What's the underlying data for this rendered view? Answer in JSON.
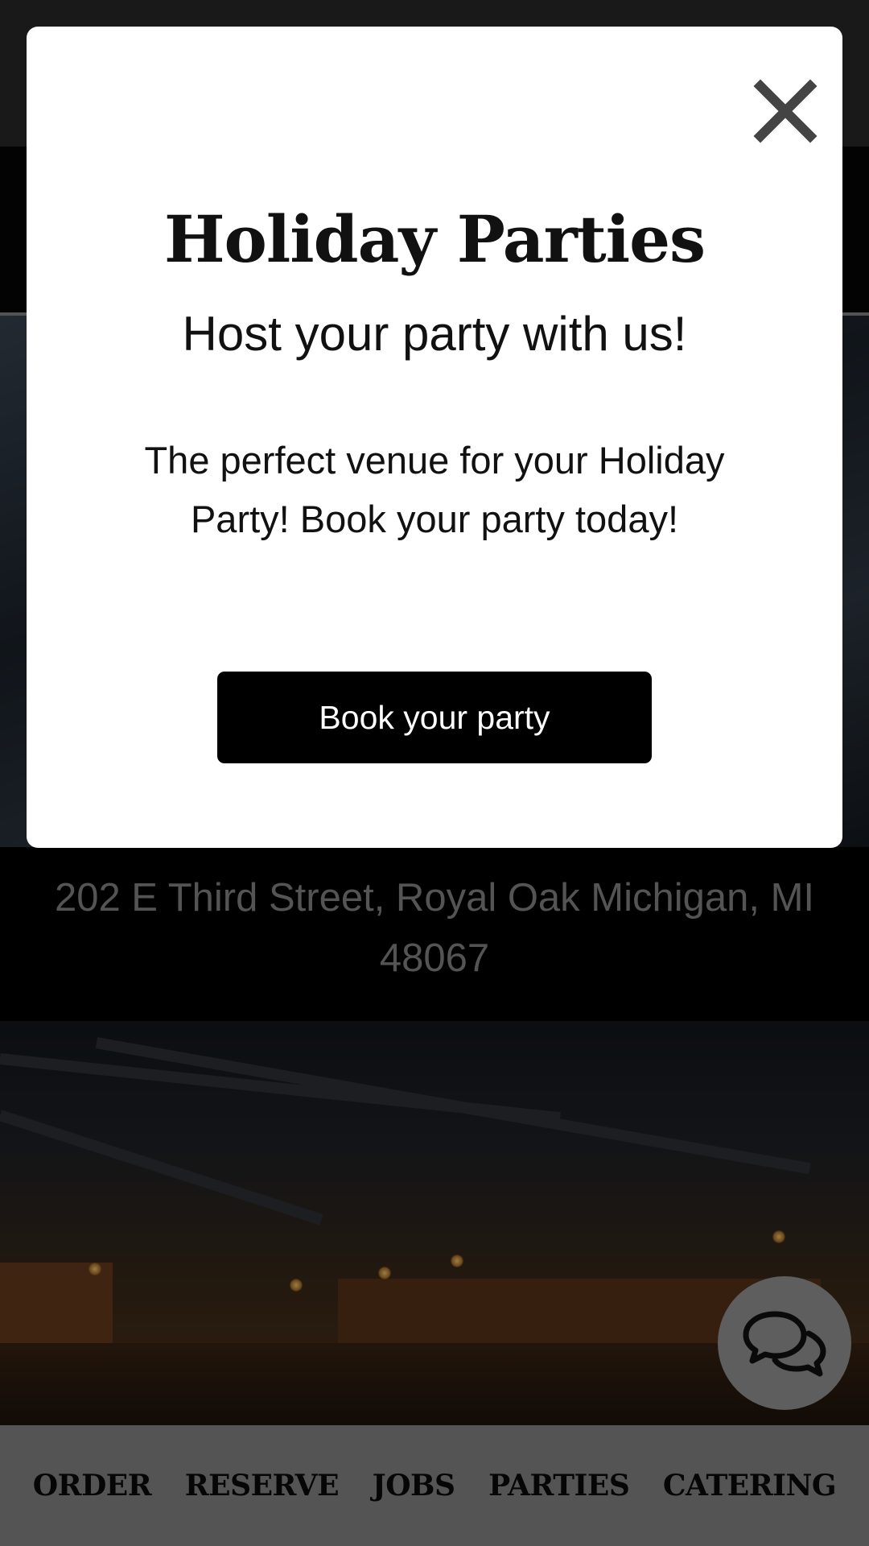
{
  "modal": {
    "title": "Holiday Parties",
    "subtitle": "Host your party with us!",
    "body": "The perfect venue for your Holiday Party! Book your party today!",
    "cta_label": "Book your party",
    "close_icon": "close-icon"
  },
  "location": {
    "address": "202 E Third Street, Royal Oak Michigan, MI 48067"
  },
  "bottom_nav": {
    "items": [
      {
        "label": "ORDER"
      },
      {
        "label": "RESERVE"
      },
      {
        "label": "JOBS"
      },
      {
        "label": "PARTIES"
      },
      {
        "label": "CATERING"
      }
    ]
  },
  "chat": {
    "icon": "chat-bubbles-icon"
  },
  "colors": {
    "modal_background": "#ffffff",
    "cta_background": "#000000",
    "nav_background": "#8c8c8c",
    "address_text": "#8c8c8c"
  }
}
